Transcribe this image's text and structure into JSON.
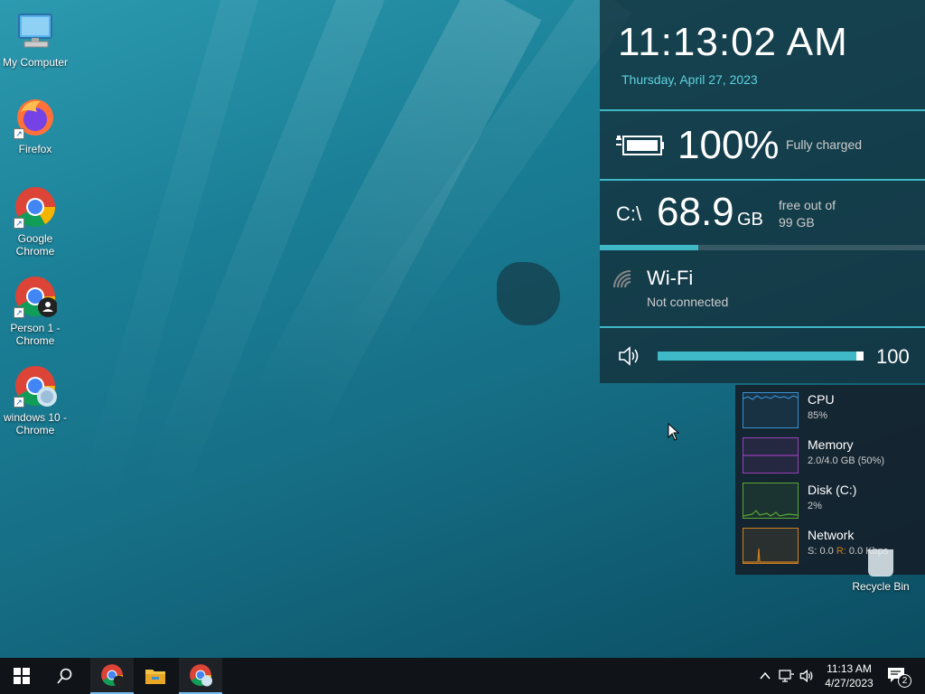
{
  "desktop": {
    "icons": [
      {
        "label": "My Computer",
        "icon": "monitor-icon"
      },
      {
        "label": "Firefox",
        "icon": "firefox-icon"
      },
      {
        "label": "Google Chrome",
        "icon": "chrome-icon"
      },
      {
        "label": "Person 1 - Chrome",
        "icon": "chrome-person-icon"
      },
      {
        "label": "windows 10 - Chrome",
        "icon": "chrome-profile-icon"
      }
    ],
    "recycle_bin": "Recycle Bin"
  },
  "widget": {
    "time": "11:13:02 AM",
    "date": "Thursday, April 27, 2023",
    "battery": {
      "percent": "100%",
      "status": "Fully charged",
      "level": 1.0
    },
    "drive": {
      "letter": "C:\\",
      "free": "68.9",
      "unit": "GB",
      "free_label": "free out of",
      "total": "99 GB",
      "used_fraction": 0.304
    },
    "wifi": {
      "name": "Wi-Fi",
      "status": "Not connected"
    },
    "volume": {
      "value": "100",
      "level": 1.0
    },
    "accent": "#3fb8c8"
  },
  "perf": [
    {
      "name": "CPU",
      "value": "85%",
      "color": "#3a8fd0"
    },
    {
      "name": "Memory",
      "value": "2.0/4.0 GB (50%)",
      "color": "#9a3fb8"
    },
    {
      "name": "Disk (C:)",
      "value": "2%",
      "color": "#5aa832"
    },
    {
      "name": "Network",
      "value_s_label": "S:",
      "value_s": "0.0",
      "value_r_label": "R:",
      "value_r": "0.0 Kbps",
      "color": "#d0801f"
    }
  ],
  "taskbar": {
    "time": "11:13 AM",
    "date": "4/27/2023",
    "notification_count": "2"
  }
}
